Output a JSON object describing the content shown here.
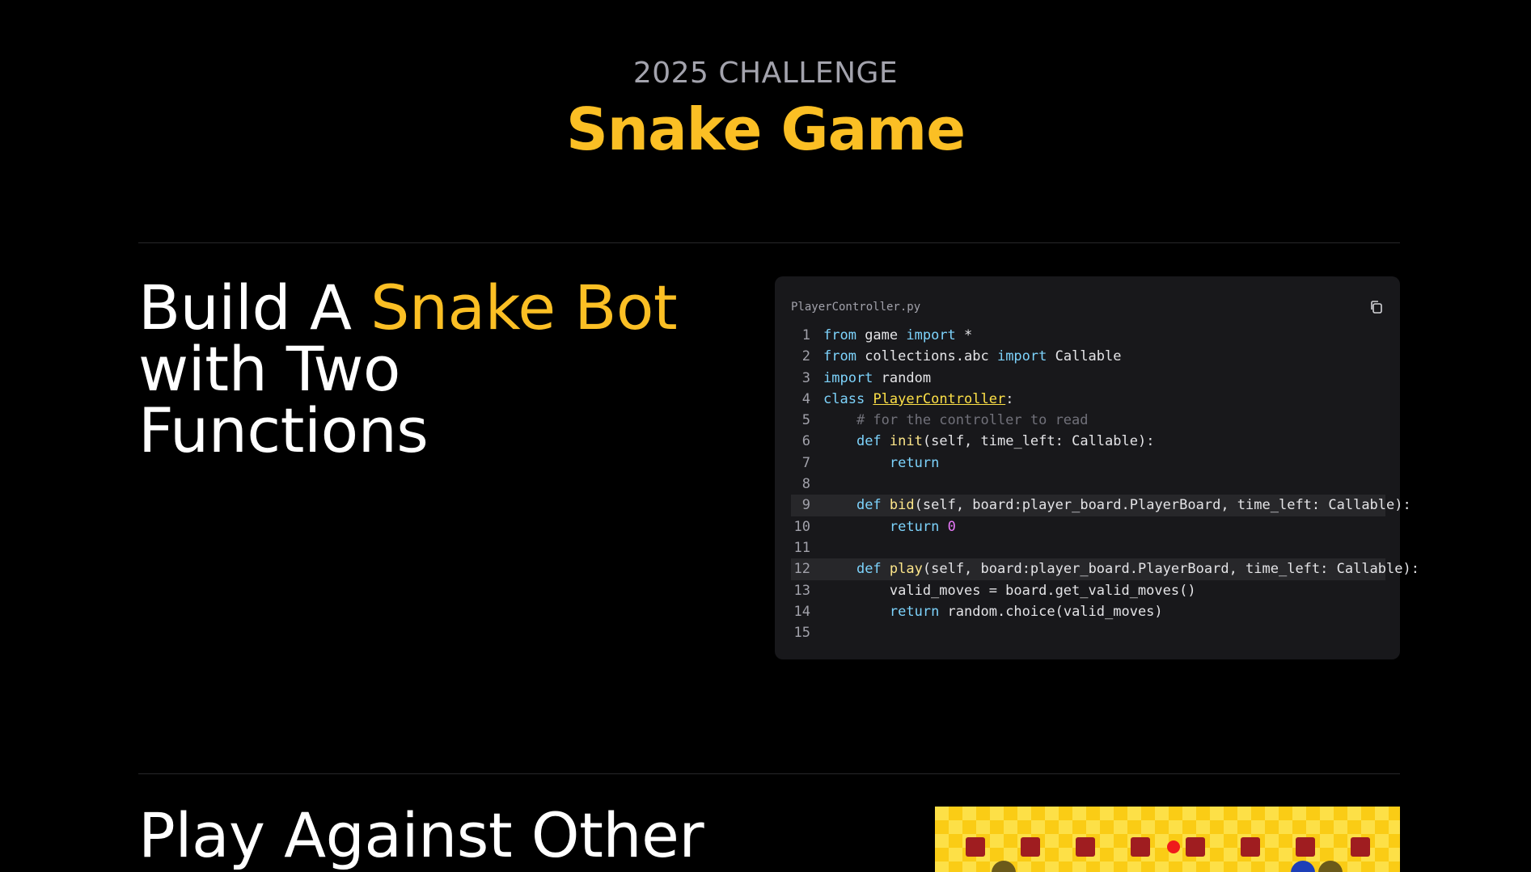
{
  "header": {
    "eyebrow": "2025 CHALLENGE",
    "title": "Snake Game"
  },
  "section1": {
    "heading_part1": "Build A ",
    "heading_accent": "Snake Bot",
    "heading_line2": "with Two",
    "heading_line3": "Functions"
  },
  "code_panel": {
    "file_name": "PlayerController.py",
    "copy_icon": "copy-icon",
    "highlighted_lines": [
      9,
      12
    ],
    "lines": [
      {
        "n": "1",
        "tokens": [
          {
            "t": "from",
            "c": "kw"
          },
          {
            "t": " game ",
            "c": ""
          },
          {
            "t": "import",
            "c": "kw"
          },
          {
            "t": " *",
            "c": ""
          }
        ]
      },
      {
        "n": "2",
        "tokens": [
          {
            "t": "from",
            "c": "kw"
          },
          {
            "t": " collections.abc ",
            "c": ""
          },
          {
            "t": "import",
            "c": "kw"
          },
          {
            "t": " Callable",
            "c": ""
          }
        ]
      },
      {
        "n": "3",
        "tokens": [
          {
            "t": "import",
            "c": "kw"
          },
          {
            "t": " random",
            "c": ""
          }
        ]
      },
      {
        "n": "4",
        "tokens": [
          {
            "t": "class",
            "c": "kw"
          },
          {
            "t": " ",
            "c": ""
          },
          {
            "t": "PlayerController",
            "c": "cls"
          },
          {
            "t": ":",
            "c": ""
          }
        ]
      },
      {
        "n": "5",
        "tokens": [
          {
            "t": "    # for the controller to read",
            "c": "cm"
          }
        ]
      },
      {
        "n": "6",
        "tokens": [
          {
            "t": "    ",
            "c": ""
          },
          {
            "t": "def",
            "c": "kw"
          },
          {
            "t": " ",
            "c": ""
          },
          {
            "t": "init",
            "c": "fn"
          },
          {
            "t": "(self, time_left: Callable):",
            "c": ""
          }
        ]
      },
      {
        "n": "7",
        "tokens": [
          {
            "t": "        ",
            "c": ""
          },
          {
            "t": "return",
            "c": "kw"
          }
        ]
      },
      {
        "n": "8",
        "tokens": []
      },
      {
        "n": "9",
        "tokens": [
          {
            "t": "    ",
            "c": ""
          },
          {
            "t": "def",
            "c": "kw"
          },
          {
            "t": " ",
            "c": ""
          },
          {
            "t": "bid",
            "c": "fn"
          },
          {
            "t": "(self, board:player_board.PlayerBoard, time_left: Callable):",
            "c": ""
          }
        ]
      },
      {
        "n": "10",
        "tokens": [
          {
            "t": "        ",
            "c": ""
          },
          {
            "t": "return",
            "c": "kw"
          },
          {
            "t": " ",
            "c": ""
          },
          {
            "t": "0",
            "c": "num"
          }
        ]
      },
      {
        "n": "11",
        "tokens": []
      },
      {
        "n": "12",
        "tokens": [
          {
            "t": "    ",
            "c": ""
          },
          {
            "t": "def",
            "c": "kw"
          },
          {
            "t": " ",
            "c": ""
          },
          {
            "t": "play",
            "c": "fn"
          },
          {
            "t": "(self, board:player_board.PlayerBoard, time_left: Callable):",
            "c": ""
          }
        ]
      },
      {
        "n": "13",
        "tokens": [
          {
            "t": "        valid_moves = board.get_valid_moves()",
            "c": ""
          }
        ]
      },
      {
        "n": "14",
        "tokens": [
          {
            "t": "        ",
            "c": ""
          },
          {
            "t": "return",
            "c": "kw"
          },
          {
            "t": " random.choice(valid_moves)",
            "c": ""
          }
        ]
      },
      {
        "n": "15",
        "tokens": []
      }
    ]
  },
  "section2": {
    "heading": "Play Against Other"
  },
  "game_preview": {
    "background_color": "#facc15",
    "wall_color": "#9f1d20",
    "apple_color": "#ef1b1b"
  },
  "colors": {
    "accent": "#fbbf24",
    "background": "#000000",
    "card": "#18181b"
  }
}
